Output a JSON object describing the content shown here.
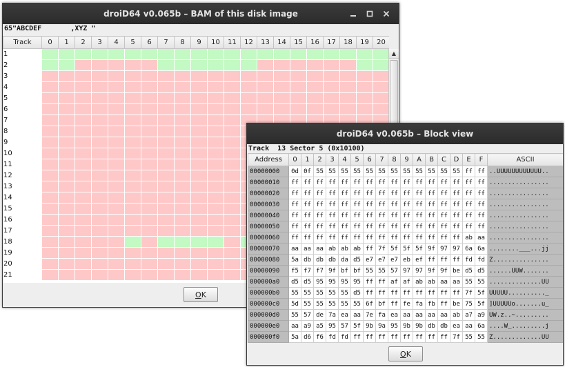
{
  "bam": {
    "title": "droiD64 v0.065b – BAM of this disk image",
    "info": "65\"ABCDEF       ,XYZ \"",
    "track_header": "Track",
    "sector_headers": [
      "0",
      "1",
      "2",
      "3",
      "4",
      "5",
      "6",
      "7",
      "8",
      "9",
      "10",
      "11",
      "12",
      "13",
      "14",
      "15",
      "16",
      "17",
      "18",
      "19",
      "20"
    ],
    "tracks": [
      {
        "label": "1",
        "cells": "fffffffffffffffffffff"
      },
      {
        "label": "2",
        "cells": "ffuuuuuffffffuuuuuuff"
      },
      {
        "label": "3",
        "cells": "uuuuuuuuuuuuuuuuuuuuu"
      },
      {
        "label": "4",
        "cells": "uuuuuuuuuuuuuuuuuuuuu"
      },
      {
        "label": "5",
        "cells": "uuuuuuuuuuuuuuuuuuuuu"
      },
      {
        "label": "6",
        "cells": "uuuuuuuuuuuuuuuuuuuuu"
      },
      {
        "label": "7",
        "cells": "uuuuuuuuuuuuuuuuuuuuu"
      },
      {
        "label": "8",
        "cells": "uuuuuuuuuuuuuuuuuuuuu"
      },
      {
        "label": "9",
        "cells": "uuuuuuuuuuuuuuuuuuuuu"
      },
      {
        "label": "10",
        "cells": "uuuuuuuuuuuuuuuuuuuuu"
      },
      {
        "label": "11",
        "cells": "uuuuuuuuuuuuuuuuuuuuu"
      },
      {
        "label": "12",
        "cells": "uuuuuuuuuuuuuuuuuuuuu"
      },
      {
        "label": "13",
        "cells": "uuuuuuuuuuuuuuuuuuuuu"
      },
      {
        "label": "14",
        "cells": "uuuuuuuuuuuuuuuuuuuuu"
      },
      {
        "label": "15",
        "cells": "uuuuuuuuuuuuuuuuuuuuu"
      },
      {
        "label": "16",
        "cells": "uuuuuuuuuuuuuuuuuuuuu"
      },
      {
        "label": "17",
        "cells": "uuuuuuuuuuuuuuuuuuuuu"
      },
      {
        "label": "18",
        "cells": "uuuuufuffffuffuuuuuuu"
      },
      {
        "label": "19",
        "cells": "uuuuuuuuuuuuuuuuuuuuu"
      },
      {
        "label": "20",
        "cells": "uuuuuuuuuuuuuuuuuuuuu"
      },
      {
        "label": "21",
        "cells": "uuuuuuuuuuuuuuuuuuuuu"
      }
    ],
    "colors": {
      "free": "#c3f9c3",
      "used": "#ffc8c8"
    },
    "ok_label": "OK",
    "ok_mnemonic": "O",
    "ok_rest": "K"
  },
  "block": {
    "title": "droiD64 v0.065b – Block view",
    "info": "Track  13 Sector 5 (0x10100)",
    "address_header": "Address",
    "hex_headers": [
      "0",
      "1",
      "2",
      "3",
      "4",
      "5",
      "6",
      "7",
      "8",
      "9",
      "A",
      "B",
      "C",
      "D",
      "E",
      "F"
    ],
    "ascii_header": "ASCII",
    "rows": [
      {
        "addr": "00000000",
        "bytes": [
          "0d",
          "0f",
          "55",
          "55",
          "55",
          "55",
          "55",
          "55",
          "55",
          "55",
          "55",
          "55",
          "55",
          "55",
          "ff",
          "ff"
        ],
        "ascii": "..UUUUUUUUUUUU.."
      },
      {
        "addr": "00000010",
        "bytes": [
          "ff",
          "ff",
          "ff",
          "ff",
          "ff",
          "ff",
          "ff",
          "ff",
          "ff",
          "ff",
          "ff",
          "ff",
          "ff",
          "ff",
          "ff",
          "ff"
        ],
        "ascii": "................"
      },
      {
        "addr": "00000020",
        "bytes": [
          "ff",
          "ff",
          "ff",
          "ff",
          "ff",
          "ff",
          "ff",
          "ff",
          "ff",
          "ff",
          "ff",
          "ff",
          "ff",
          "ff",
          "ff",
          "ff"
        ],
        "ascii": "................"
      },
      {
        "addr": "00000030",
        "bytes": [
          "ff",
          "ff",
          "ff",
          "ff",
          "ff",
          "ff",
          "ff",
          "ff",
          "ff",
          "ff",
          "ff",
          "ff",
          "ff",
          "ff",
          "ff",
          "ff"
        ],
        "ascii": "................"
      },
      {
        "addr": "00000040",
        "bytes": [
          "ff",
          "ff",
          "ff",
          "ff",
          "ff",
          "ff",
          "ff",
          "ff",
          "ff",
          "ff",
          "ff",
          "ff",
          "ff",
          "ff",
          "ff",
          "ff"
        ],
        "ascii": "................"
      },
      {
        "addr": "00000050",
        "bytes": [
          "ff",
          "ff",
          "ff",
          "ff",
          "ff",
          "ff",
          "ff",
          "ff",
          "ff",
          "ff",
          "ff",
          "ff",
          "ff",
          "ff",
          "ff",
          "ff"
        ],
        "ascii": "................"
      },
      {
        "addr": "00000060",
        "bytes": [
          "ff",
          "ff",
          "ff",
          "ff",
          "ff",
          "ff",
          "ff",
          "ff",
          "ff",
          "ff",
          "ff",
          "ff",
          "ff",
          "ff",
          "ab",
          "aa"
        ],
        "ascii": "................"
      },
      {
        "addr": "00000070",
        "bytes": [
          "aa",
          "aa",
          "aa",
          "ab",
          "ab",
          "ab",
          "ff",
          "7f",
          "5f",
          "5f",
          "5f",
          "9f",
          "97",
          "97",
          "6a",
          "6a"
        ],
        "ascii": "........___...jj"
      },
      {
        "addr": "00000080",
        "bytes": [
          "5a",
          "db",
          "db",
          "db",
          "da",
          "d5",
          "e7",
          "e7",
          "e7",
          "eb",
          "ef",
          "ff",
          "ff",
          "ff",
          "fd",
          "fd"
        ],
        "ascii": "Z..............."
      },
      {
        "addr": "00000090",
        "bytes": [
          "f5",
          "f7",
          "f7",
          "9f",
          "bf",
          "bf",
          "55",
          "55",
          "57",
          "97",
          "97",
          "9f",
          "9f",
          "be",
          "d5",
          "d5"
        ],
        "ascii": "......UUW......."
      },
      {
        "addr": "000000a0",
        "bytes": [
          "d5",
          "d5",
          "95",
          "95",
          "95",
          "95",
          "ff",
          "ff",
          "af",
          "af",
          "ab",
          "ab",
          "aa",
          "aa",
          "55",
          "55"
        ],
        "ascii": "..............UU"
      },
      {
        "addr": "000000b0",
        "bytes": [
          "55",
          "55",
          "55",
          "55",
          "55",
          "d5",
          "ff",
          "ff",
          "ff",
          "ff",
          "ff",
          "ff",
          "ff",
          "ff",
          "7f",
          "5f"
        ],
        "ascii": "UUUUU.........._"
      },
      {
        "addr": "000000c0",
        "bytes": [
          "5d",
          "55",
          "55",
          "55",
          "55",
          "55",
          "6f",
          "bf",
          "ff",
          "fe",
          "fa",
          "fb",
          "ff",
          "be",
          "75",
          "5f"
        ],
        "ascii": "]UUUUUo.......u_"
      },
      {
        "addr": "000000d0",
        "bytes": [
          "55",
          "57",
          "de",
          "7a",
          "ea",
          "aa",
          "7e",
          "fa",
          "ea",
          "aa",
          "aa",
          "aa",
          "aa",
          "ab",
          "a7",
          "a9"
        ],
        "ascii": "UW.z..~........."
      },
      {
        "addr": "000000e0",
        "bytes": [
          "aa",
          "a9",
          "a5",
          "95",
          "57",
          "5f",
          "9b",
          "9a",
          "95",
          "9b",
          "9b",
          "db",
          "db",
          "ea",
          "aa",
          "6a"
        ],
        "ascii": "....W_.........j"
      },
      {
        "addr": "000000f0",
        "bytes": [
          "5a",
          "d6",
          "f6",
          "fd",
          "fd",
          "ff",
          "ff",
          "ff",
          "ff",
          "ff",
          "ff",
          "ff",
          "ff",
          "7f",
          "55",
          "55"
        ],
        "ascii": "Z.............UU"
      }
    ],
    "ok_mnemonic": "O",
    "ok_rest": "K"
  }
}
